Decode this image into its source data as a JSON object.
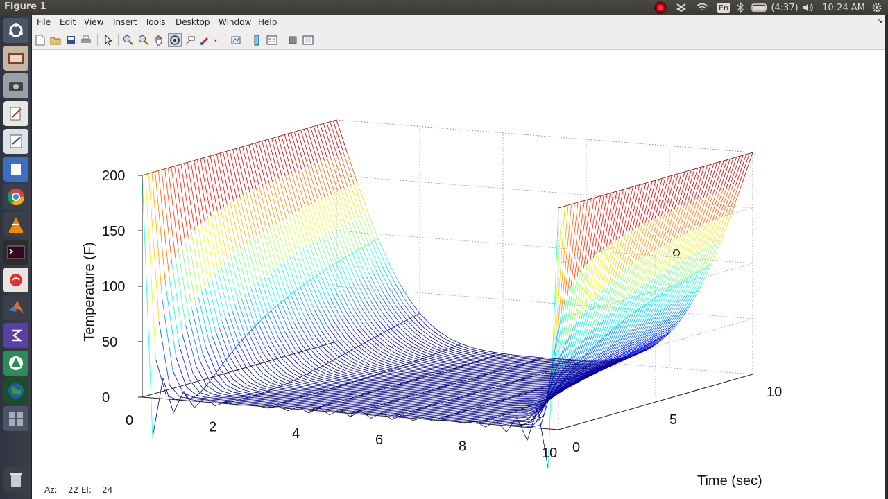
{
  "window": {
    "title": "Figure 1"
  },
  "topbar": {
    "keyboard_layout": "En",
    "battery": "(4:37)",
    "time": "10:24 AM",
    "icons": [
      "record-icon",
      "dropbox-icon",
      "wifi-icon",
      "keyboard-icon",
      "bluetooth-icon",
      "battery-icon",
      "volume-icon",
      "settings-gear-icon"
    ]
  },
  "launcher": {
    "icons": [
      "ubuntu-dash-icon",
      "file-manager-icon",
      "screenshot-icon",
      "text-editor-icon",
      "notes-icon",
      "document-viewer-icon",
      "chrome-icon",
      "vlc-icon",
      "terminal-icon",
      "pdf-viewer-icon",
      "matlab-icon",
      "emacs-icon",
      "software-updater-icon",
      "earth-icon",
      "workspace-switcher-icon",
      "trash-icon"
    ]
  },
  "menubar": {
    "items": [
      "File",
      "Edit",
      "View",
      "Insert",
      "Tools",
      "Desktop",
      "Window",
      "Help"
    ]
  },
  "toolbar": {
    "buttons": [
      "new-figure-icon",
      "open-file-icon",
      "save-icon",
      "print-icon",
      "edit-plot-icon",
      "zoom-in-icon",
      "zoom-out-icon",
      "pan-icon",
      "rotate-3d-icon",
      "data-cursor-icon",
      "brush-icon",
      "link-plot-icon",
      "insert-colorbar-icon",
      "insert-legend-icon",
      "hide-plot-tools-icon",
      "show-plot-tools-icon"
    ]
  },
  "status": {
    "az_label": "Az:",
    "az_value": "22",
    "el_label": "El:",
    "el_value": "24"
  },
  "chart_data": {
    "type": "mesh3d",
    "title": "",
    "zlabel": "Temperature (F)",
    "ylabel": "Time (sec)",
    "xlabel": "",
    "x_ticks": [
      "0",
      "2",
      "4",
      "6",
      "8",
      "10"
    ],
    "y_ticks": [
      "0",
      "5",
      "10"
    ],
    "z_ticks": [
      "0",
      "50",
      "100",
      "150",
      "200"
    ],
    "xlim": [
      0,
      10
    ],
    "ylim": [
      0,
      10
    ],
    "zlim": [
      0,
      200
    ],
    "boundary_temperature": 200,
    "initial_temperature": 0,
    "colormap": "jet",
    "view": {
      "azimuth": 22,
      "elevation": 24
    },
    "grid": true
  }
}
